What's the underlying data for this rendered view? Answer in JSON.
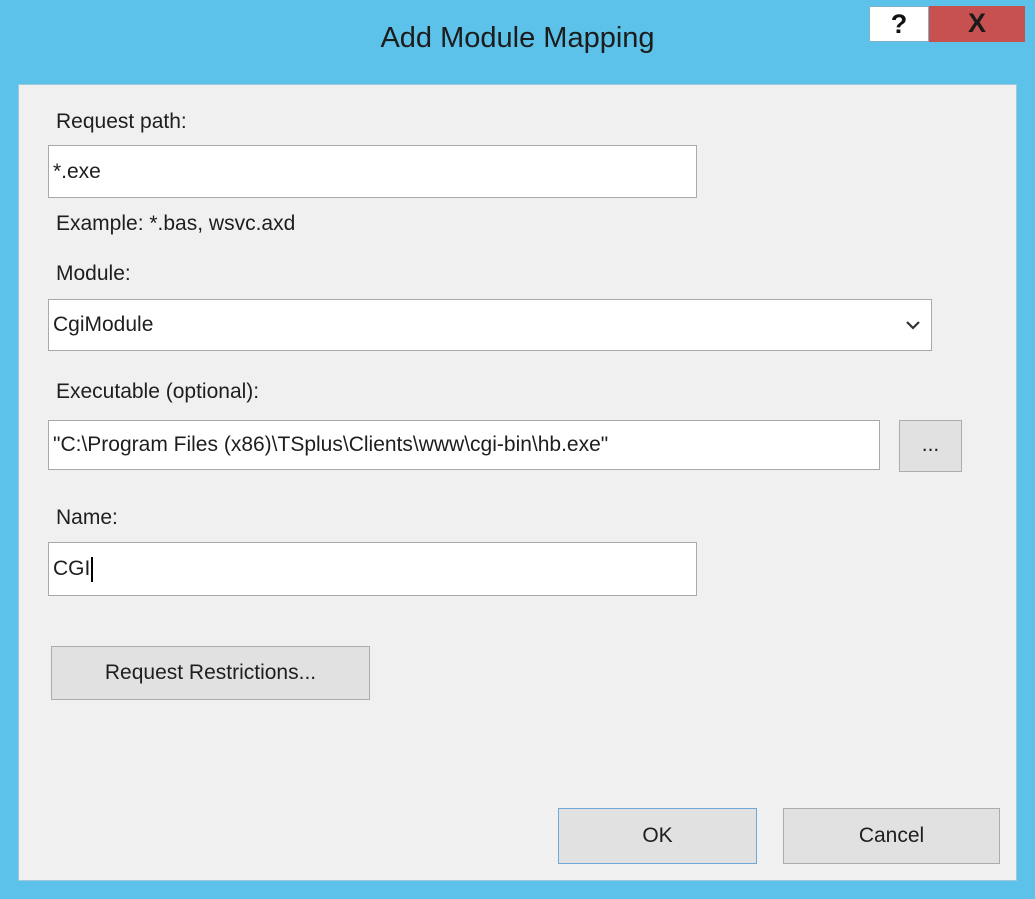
{
  "window": {
    "title": "Add Module Mapping",
    "help_label": "?",
    "close_label": "X"
  },
  "form": {
    "request_path_label": "Request path:",
    "request_path_value": "*.exe",
    "example_text": "Example: *.bas, wsvc.axd",
    "module_label": "Module:",
    "module_value": "CgiModule",
    "executable_label": "Executable (optional):",
    "executable_value": "\"C:\\Program Files (x86)\\TSplus\\Clients\\www\\cgi-bin\\hb.exe\"",
    "browse_label": "...",
    "name_label": "Name:",
    "name_value": "CGI",
    "request_restrictions_label": "Request Restrictions..."
  },
  "footer": {
    "ok_label": "OK",
    "cancel_label": "Cancel"
  },
  "icons": {
    "dropdown": "chevron-down-icon"
  }
}
